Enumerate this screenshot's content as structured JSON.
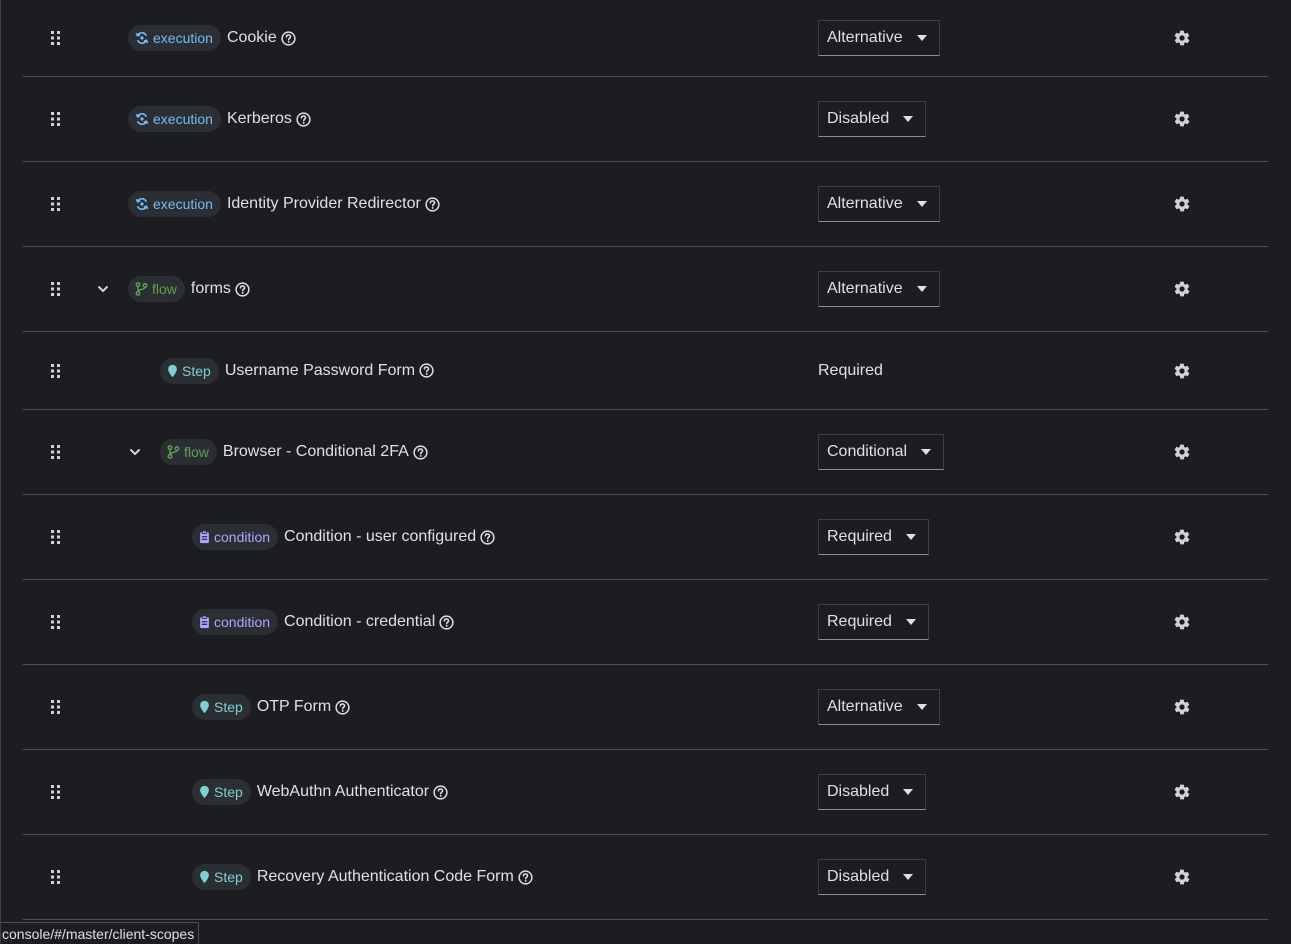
{
  "rows": [
    {
      "kind": "execution",
      "badge": "execution",
      "name": "Cookie",
      "requirement": "Alternative",
      "requirement_type": "select"
    },
    {
      "kind": "execution",
      "badge": "execution",
      "name": "Kerberos",
      "requirement": "Disabled",
      "requirement_type": "select"
    },
    {
      "kind": "execution",
      "badge": "execution",
      "name": "Identity Provider Redirector",
      "requirement": "Alternative",
      "requirement_type": "select"
    },
    {
      "kind": "flow",
      "badge": "flow",
      "name": "forms",
      "requirement": "Alternative",
      "requirement_type": "select"
    },
    {
      "kind": "step",
      "badge": "Step",
      "name": "Username Password Form",
      "requirement": "Required",
      "requirement_type": "text"
    },
    {
      "kind": "flow",
      "badge": "flow",
      "name": "Browser - Conditional 2FA",
      "requirement": "Conditional",
      "requirement_type": "select"
    },
    {
      "kind": "condition",
      "badge": "condition",
      "name": "Condition - user configured",
      "requirement": "Required",
      "requirement_type": "select"
    },
    {
      "kind": "condition",
      "badge": "condition",
      "name": "Condition - credential",
      "requirement": "Required",
      "requirement_type": "select"
    },
    {
      "kind": "step",
      "badge": "Step",
      "name": "OTP Form",
      "requirement": "Alternative",
      "requirement_type": "select"
    },
    {
      "kind": "step",
      "badge": "Step",
      "name": "WebAuthn Authenticator",
      "requirement": "Disabled",
      "requirement_type": "select"
    },
    {
      "kind": "step",
      "badge": "Step",
      "name": "Recovery Authentication Code Form",
      "requirement": "Disabled",
      "requirement_type": "select"
    }
  ],
  "status_url": "console/#/master/client-scopes",
  "icons": {
    "drag": "drag-handle-icon",
    "toggle": "chevron-down-icon",
    "help": "help-circle-icon",
    "settings": "gear-icon",
    "execution": "sync-icon",
    "flow": "code-branch-icon",
    "step": "map-marker-icon",
    "condition": "clipboard-icon"
  },
  "colors": {
    "execution": "#73bcf7",
    "flow": "#5ba352",
    "step": "#7dd1d2",
    "condition": "#b2a3ff"
  }
}
